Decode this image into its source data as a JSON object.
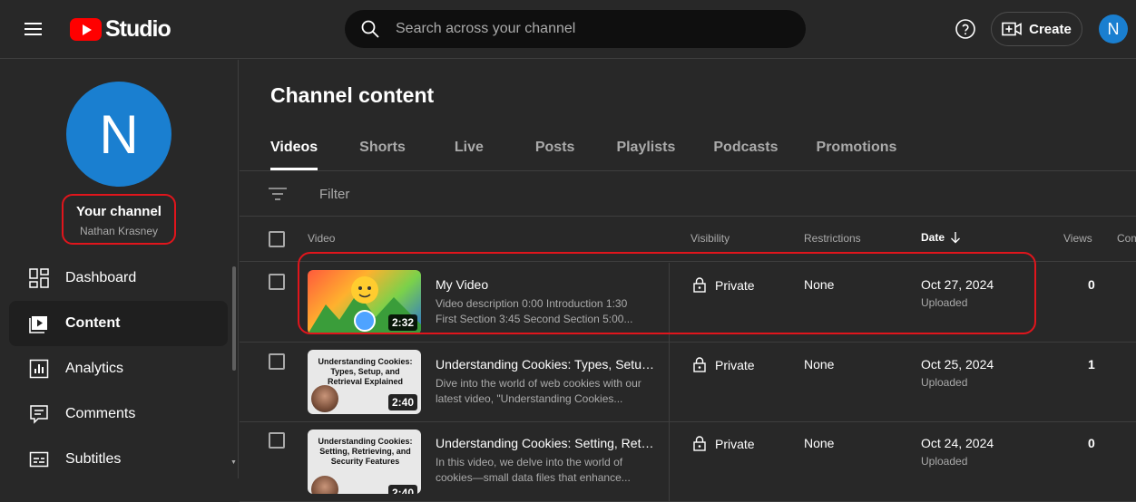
{
  "header": {
    "logo_text": "Studio",
    "search_placeholder": "Search across your channel",
    "create_label": "Create",
    "avatar_initial": "N"
  },
  "sidebar": {
    "avatar_initial": "N",
    "channel_label": "Your channel",
    "channel_name": "Nathan Krasney",
    "items": [
      {
        "label": "Dashboard",
        "icon": "dashboard-icon"
      },
      {
        "label": "Content",
        "icon": "content-icon",
        "active": true
      },
      {
        "label": "Analytics",
        "icon": "analytics-icon"
      },
      {
        "label": "Comments",
        "icon": "comments-icon"
      },
      {
        "label": "Subtitles",
        "icon": "subtitles-icon"
      }
    ]
  },
  "main": {
    "title": "Channel content",
    "tabs": [
      "Videos",
      "Shorts",
      "Live",
      "Posts",
      "Playlists",
      "Podcasts",
      "Promotions"
    ],
    "filter_placeholder": "Filter",
    "columns": {
      "video": "Video",
      "visibility": "Visibility",
      "restrictions": "Restrictions",
      "date": "Date",
      "views": "Views",
      "comments": "Com"
    },
    "rows": [
      {
        "title": "My Video",
        "description": "Video description 0:00 Introduction 1:30 First Section 3:45 Second Section 5:00...",
        "duration": "2:32",
        "visibility": "Private",
        "restrictions": "None",
        "date": "Oct 27, 2024",
        "status": "Uploaded",
        "views": "0"
      },
      {
        "title": "Understanding Cookies: Types, Setup, ...",
        "description": "Dive into the world of web cookies with our latest video, \"Understanding Cookies...",
        "duration": "2:40",
        "thumb_caption": "Understanding Cookies: Types, Setup, and Retrieval Explained",
        "visibility": "Private",
        "restrictions": "None",
        "date": "Oct 25, 2024",
        "status": "Uploaded",
        "views": "1"
      },
      {
        "title": "Understanding Cookies: Setting, Retrie...",
        "description": "In this video, we delve into the world of cookies—small data files that enhance...",
        "duration": "2:40",
        "thumb_caption": "Understanding Cookies: Setting, Retrieving, and Security Features",
        "visibility": "Private",
        "restrictions": "None",
        "date": "Oct 24, 2024",
        "status": "Uploaded",
        "views": "0"
      }
    ]
  },
  "colors": {
    "background": "#282828",
    "accent_red": "#ff0000",
    "avatar_blue": "#1a7fd0",
    "highlight_red": "#e0151c"
  }
}
